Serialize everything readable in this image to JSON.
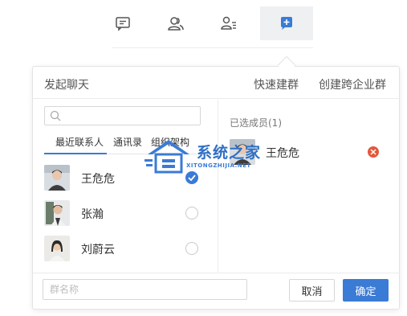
{
  "toolbar": {
    "items": [
      {
        "icon": "message-icon"
      },
      {
        "icon": "contacts-icon"
      },
      {
        "icon": "contact-list-icon"
      },
      {
        "icon": "add-icon",
        "active": true
      }
    ]
  },
  "panel": {
    "title": "发起聊天",
    "quick_group": "快速建群",
    "cross_org_group": "创建跨企业群"
  },
  "search": {
    "placeholder": ""
  },
  "tabs": [
    "最近联系人",
    "通讯录",
    "组织架构"
  ],
  "contacts": [
    {
      "name": "王危危",
      "selected": true
    },
    {
      "name": "张瀚",
      "selected": false
    },
    {
      "name": "刘蔚云",
      "selected": false
    }
  ],
  "selected": {
    "title": "已选成员(1)",
    "members": [
      {
        "name": "王危危"
      }
    ]
  },
  "watermark": {
    "main": "系统之家",
    "sub": "XITONGZHIJIA.NET"
  },
  "footer": {
    "group_name_placeholder": "群名称",
    "cancel_label": "取消",
    "confirm_label": "确定"
  },
  "colors": {
    "accent": "#3a7bd5",
    "remove": "#e5573c"
  }
}
